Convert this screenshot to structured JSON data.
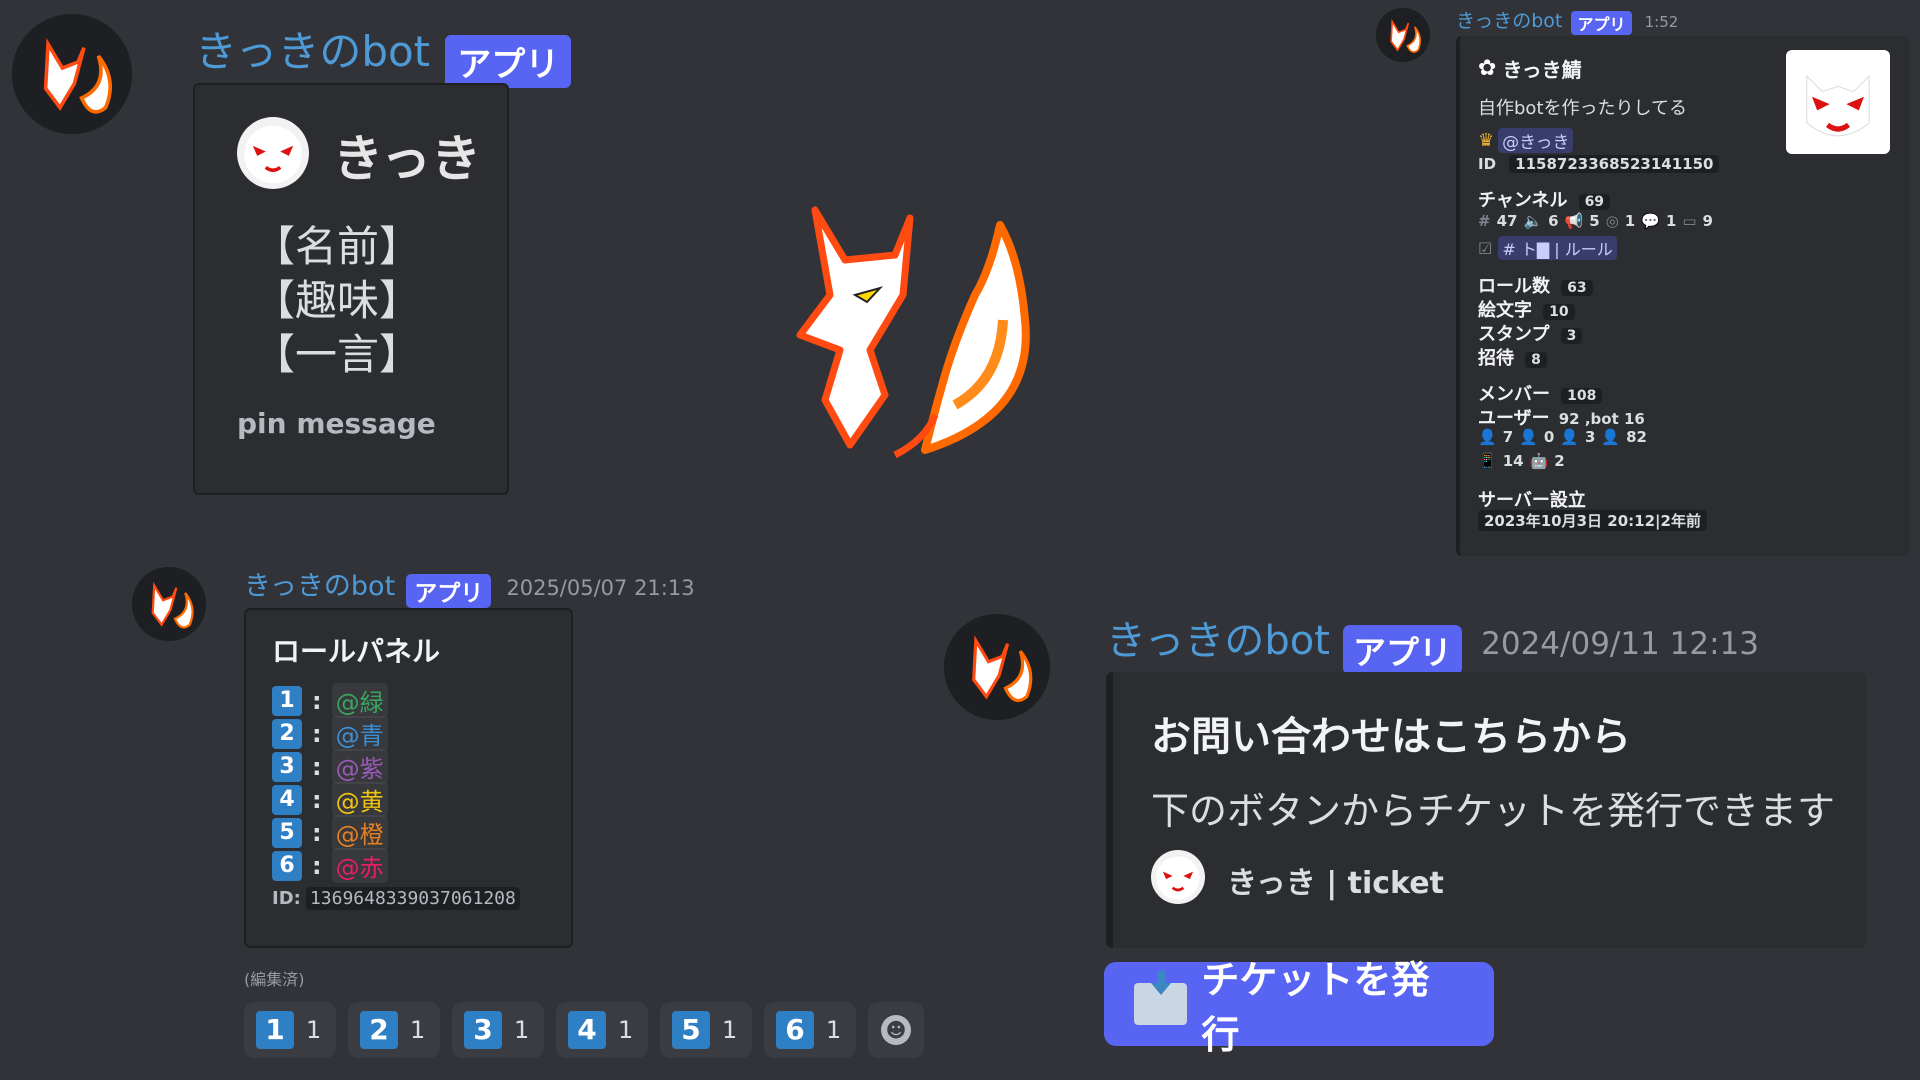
{
  "bot": {
    "name": "きっきのbot",
    "badge": "アプリ"
  },
  "colors": {
    "blurple": "#5865f2",
    "background": "#313338",
    "embed": "#2b2d31",
    "name_blue": "#4e9ad6"
  },
  "profile_message": {
    "embed": {
      "title": "きっき",
      "fields": [
        "【名前】",
        "【趣味】",
        "【一言】"
      ],
      "footer": "pin message"
    }
  },
  "server_message": {
    "timestamp": "1:52",
    "embed": {
      "server_name": "きっき鯖",
      "description": "自作botを作ったりしてる",
      "owner": "@きっき",
      "id_label": "ID",
      "id_value": "1158723368523141150",
      "channels_label": "チャンネル",
      "channels_count": "69",
      "channel_breakdown": [
        "47",
        "6",
        "5",
        "1",
        "1",
        "9"
      ],
      "rules_channel": "# ト▇ | ルール",
      "roles_label": "ロール数",
      "roles_count": "63",
      "emoji_label": "絵文字",
      "emoji_count": "10",
      "stamp_label": "スタンプ",
      "stamp_count": "3",
      "invite_label": "招待",
      "invite_count": "8",
      "members_label": "メンバー",
      "members_count": "108",
      "users_label": "ユーザー",
      "users_value": "92 ,bot 16",
      "status_row1": [
        "7",
        "0",
        "3",
        "82"
      ],
      "status_row2": [
        "14",
        "2"
      ],
      "created_label": "サーバー設立",
      "created_value": "2023年10月3日 20:12|2年前"
    }
  },
  "role_message": {
    "timestamp": "2025/05/07 21:13",
    "embed": {
      "title": "ロールパネル",
      "roles": [
        {
          "num": "1",
          "name": "@緑",
          "color": "#3ba55c"
        },
        {
          "num": "2",
          "name": "@青",
          "color": "#3b8fd6"
        },
        {
          "num": "3",
          "name": "@紫",
          "color": "#9b59b6"
        },
        {
          "num": "4",
          "name": "@黄",
          "color": "#f1c40f"
        },
        {
          "num": "5",
          "name": "@橙",
          "color": "#e67e22"
        },
        {
          "num": "6",
          "name": "@赤",
          "color": "#e91e63"
        }
      ],
      "id_label": "ID:",
      "id_value": "1369648339037061208"
    },
    "edited": "(編集済)",
    "reactions": [
      {
        "emoji": "1",
        "count": "1"
      },
      {
        "emoji": "2",
        "count": "1"
      },
      {
        "emoji": "3",
        "count": "1"
      },
      {
        "emoji": "4",
        "count": "1"
      },
      {
        "emoji": "5",
        "count": "1"
      },
      {
        "emoji": "6",
        "count": "1"
      }
    ]
  },
  "ticket_message": {
    "timestamp": "2024/09/11 12:13",
    "embed": {
      "title": "お問い合わせはこちらから",
      "description": "下のボタンからチケットを発行できます",
      "footer": "きっき | ticket"
    },
    "button": "チケットを発行"
  }
}
